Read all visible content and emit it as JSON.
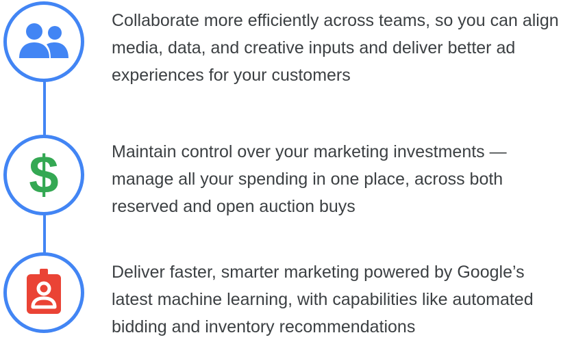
{
  "features": [
    {
      "icon": "people-icon",
      "icon_color": "#4285f4",
      "text": "Collaborate more efficiently across teams, so you can align media, data, and creative inputs and deliver better ad experiences for your customers"
    },
    {
      "icon": "dollar-icon",
      "icon_color": "#34a853",
      "text": "Maintain control over your marketing investments — manage all your spending in one place, across both reserved and open auction buys"
    },
    {
      "icon": "badge-icon",
      "icon_color": "#ea4335",
      "text": "Deliver faster, smarter marketing powered by Google’s latest machine learning, with capabilities like automated bidding and inventory recommendations"
    }
  ],
  "colors": {
    "circle_border": "#4285f4",
    "connector": "#4285f4",
    "text": "#3c4043"
  }
}
